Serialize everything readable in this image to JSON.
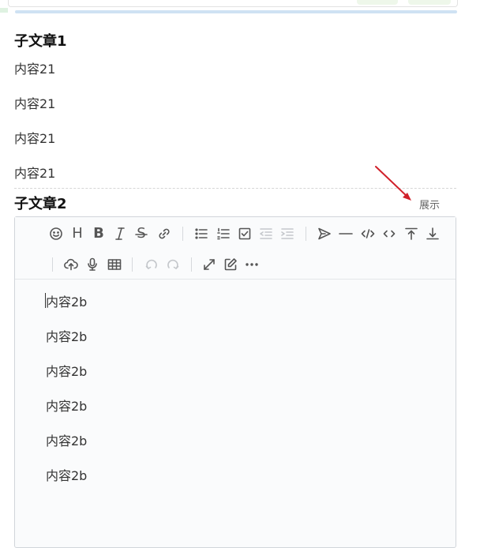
{
  "section1": {
    "title": "子文章1",
    "paragraphs": [
      "内容21",
      "内容21",
      "内容21",
      "内容21"
    ]
  },
  "section2": {
    "title": "子文章2",
    "toggle_label": "展示",
    "editor": {
      "toolbar": {
        "row1": [
          "emoji-icon",
          "heading-icon",
          "bold-icon",
          "italic-icon",
          "strikethrough-icon",
          "link-icon",
          "unordered-list-icon",
          "ordered-list-icon",
          "checklist-icon",
          "outdent-icon",
          "indent-icon",
          "quote-icon",
          "horizontal-rule-icon",
          "code-block-icon",
          "inline-code-icon",
          "insert-before-icon",
          "insert-after-icon"
        ],
        "row2": [
          "upload-icon",
          "record-icon",
          "table-icon",
          "undo-icon",
          "redo-icon",
          "fullscreen-icon",
          "edit-mode-icon",
          "more-icon"
        ],
        "glyphs": {
          "heading": "H",
          "bold": "B",
          "italic": "I",
          "strike": "S"
        }
      },
      "lines": [
        "内容2b",
        "内容2b",
        "内容2b",
        "内容2b",
        "内容2b",
        "内容2b"
      ]
    }
  },
  "colors": {
    "annotation_arrow": "#d0202a",
    "toolbar_icon": "#555555",
    "disabled_icon": "#c4c7cb"
  }
}
